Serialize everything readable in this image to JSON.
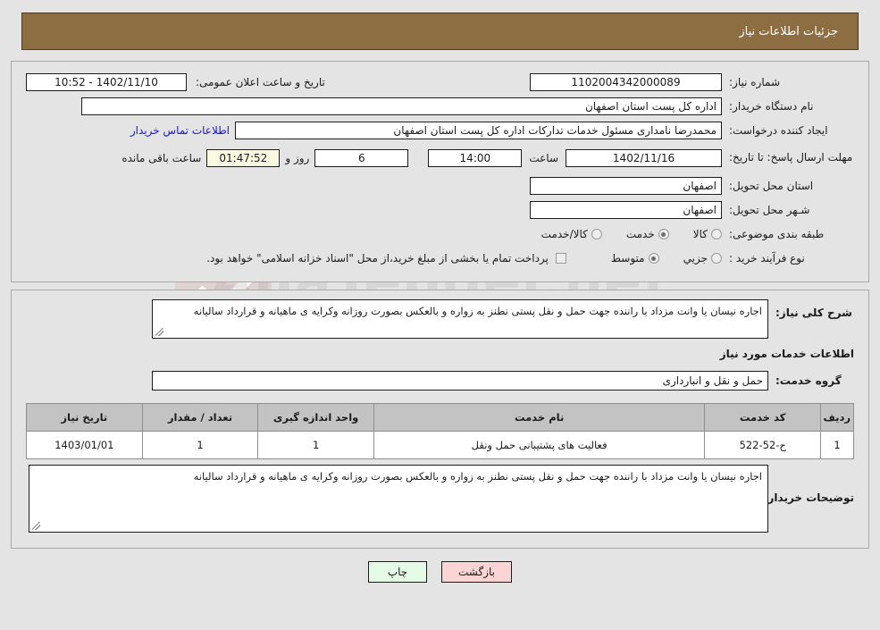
{
  "header": {
    "title": "جزئیات اطلاعات نیاز",
    "bg_color": "#8d6e43",
    "text_color": "#ffffff"
  },
  "watermark": {
    "site": "AnaTender.net"
  },
  "summary": {
    "need_number_label": "شماره نیاز:",
    "need_number_value": "1102004342000089",
    "announce_label": "تاریخ و ساعت اعلان عمومی:",
    "announce_value": "1402/11/10 - 10:52",
    "buyer_org_label": "نام دستگاه خریدار:",
    "buyer_org_value": "اداره کل پست استان اصفهان",
    "requester_label": "ایجاد کننده درخواست:",
    "requester_value": "محمدرضا نامداری مسئول خدمات تدارکات اداره کل پست استان اصفهان",
    "contact_link": "اطلاعات تماس خریدار",
    "deadline_label": "مهلت ارسال پاسخ: تا تاریخ:",
    "deadline_date": "1402/11/16",
    "deadline_time_label": "ساعت",
    "deadline_time": "14:00",
    "days_remaining": "6",
    "days_label": "روز و",
    "countdown": "01:47:52",
    "countdown_suffix": "ساعت باقی مانده",
    "province_label": "استان محل تحویل:",
    "province_value": "اصفهان",
    "city_label": "شـهر محل تحویل:",
    "city_value": "اصفهان",
    "category_label": "طبقه بندی موضوعی:",
    "category_options": [
      {
        "label": "کالا",
        "checked": false
      },
      {
        "label": "خدمت",
        "checked": true
      },
      {
        "label": "کالا/خدمت",
        "checked": false
      }
    ],
    "process_label": "نوع فرآیند خرید :",
    "process_options": [
      {
        "label": "جزیي",
        "checked": false
      },
      {
        "label": "متوسط",
        "checked": true
      }
    ],
    "treasury_checked": false,
    "treasury_note": "پرداخت تمام یا بخشی از مبلغ خرید،از محل \"اسناد خزانه اسلامی\" خواهد بود."
  },
  "detail": {
    "description_label": "شرح کلی نیاز:",
    "description_value": "اجاره نیسان یا وانت مزداد با راننده جهت حمل و نقل پستی نطنز به زواره و بالعکس بصورت روزانه وکرایه ی ماهیانه و قرارداد سالیانه",
    "services_heading": "اطلاعات خدمات مورد نیاز",
    "service_group_label": "گروه خدمت:",
    "service_group_value": "حمل و نقل و انبارداری",
    "table": {
      "columns": [
        "ردیف",
        "کد خدمت",
        "نام خدمت",
        "واحد اندازه گیری",
        "تعداد / مقدار",
        "تاریخ نیاز"
      ],
      "rows": [
        {
          "index": "1",
          "service_code": "ح-52-522",
          "service_name": "فعالیت های پشتیبانی حمل ونقل",
          "unit": "1",
          "quantity": "1",
          "need_date": "1403/01/01"
        }
      ]
    },
    "buyer_notes_label": "توضیحات خریدار:",
    "buyer_notes_value": "اجاره نیسان یا وانت مزداد با راننده جهت حمل و نقل پستی نطنز به زواره و بالعکس بصورت روزانه وکرایه ی ماهیانه و قرارداد سالیانه"
  },
  "footer": {
    "back_label": "بازگشت",
    "print_label": "چاپ",
    "back_color": "#fbd4d4",
    "print_color": "#e5fbe5"
  }
}
